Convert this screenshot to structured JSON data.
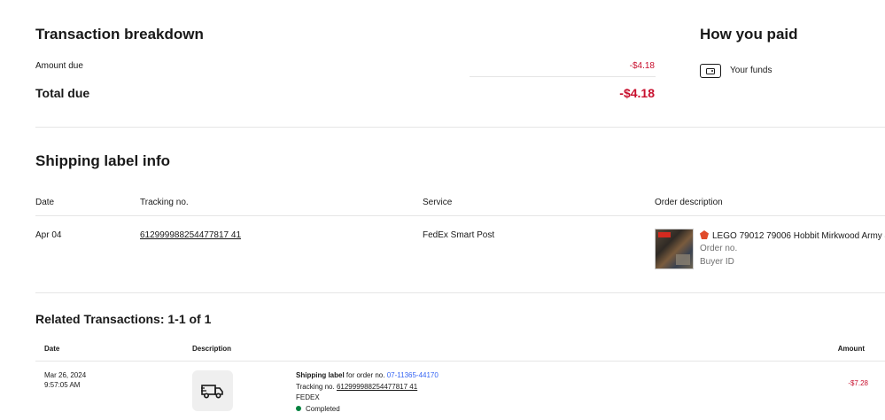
{
  "breakdown": {
    "title": "Transaction breakdown",
    "amount_due_label": "Amount due",
    "amount_due_value": "-$4.18",
    "total_due_label": "Total due",
    "total_due_value": "-$4.18"
  },
  "payment": {
    "title": "How you paid",
    "method_icon": "wallet-icon",
    "method_label": "Your funds"
  },
  "shipping": {
    "title": "Shipping label info",
    "headers": {
      "date": "Date",
      "tracking": "Tracking no.",
      "service": "Service",
      "order": "Order description"
    },
    "row": {
      "date": "Apr 04",
      "tracking": "612999988254477817 41",
      "service": "FedEx Smart Post",
      "item_title": "LEGO 79012 79006 Hobbit Mirkwood Army &",
      "order_no_label": "Order no.",
      "buyer_id_label": "Buyer ID"
    }
  },
  "related": {
    "title": "Related Transactions: 1-1 of 1",
    "headers": {
      "date": "Date",
      "description": "Description",
      "amount": "Amount"
    },
    "row": {
      "date": "Mar 26, 2024",
      "time": "9:57:05 AM",
      "icon": "truck-icon",
      "label_bold": "Shipping label",
      "label_rest": " for order no. ",
      "order_no": "07-11365-44170",
      "tracking_label": "Tracking no. ",
      "tracking_no": "612999988254477817 41",
      "carrier": "FEDEX",
      "status": "Completed",
      "amount": "-$7.28"
    }
  },
  "colors": {
    "negative": "#c8102e",
    "link": "#3665f3",
    "success": "#05823f"
  }
}
